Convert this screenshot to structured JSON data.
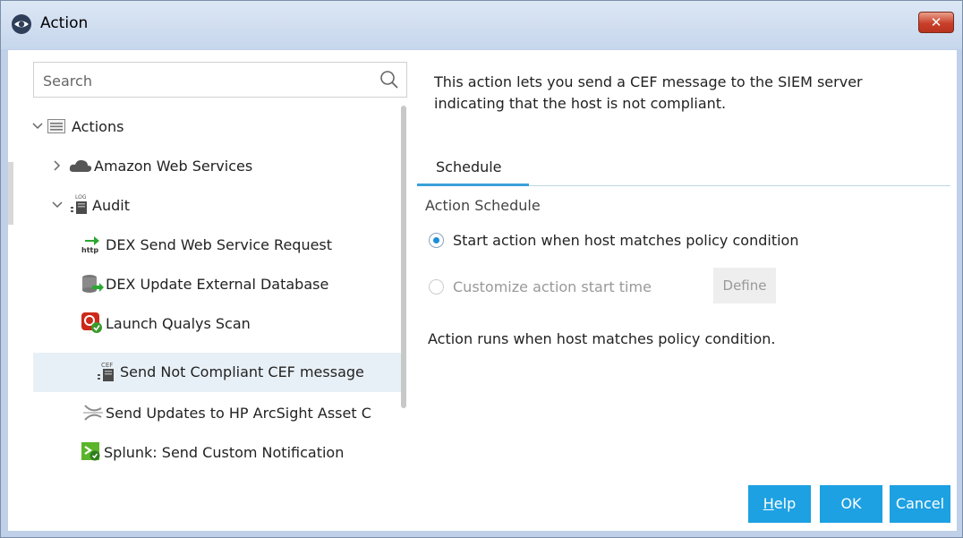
{
  "window": {
    "title": "Action",
    "close_glyph": "✕"
  },
  "search": {
    "placeholder": "Search"
  },
  "tree": {
    "root": "Actions",
    "items": [
      {
        "label": "Amazon Web Services",
        "icon": "cloud-icon"
      },
      {
        "label": "Audit",
        "icon": "log-icon"
      },
      {
        "label": "DEX Send Web Service Request",
        "icon": "http-icon"
      },
      {
        "label": "DEX Update External Database",
        "icon": "database-icon"
      },
      {
        "label": "Launch Qualys Scan",
        "icon": "qualys-icon"
      },
      {
        "label": "Send Not Compliant CEF message",
        "icon": "cef-icon",
        "selected": true
      },
      {
        "label": "Send Updates to HP ArcSight Asset C",
        "icon": "arcsight-icon"
      },
      {
        "label": "Splunk: Send Custom Notification",
        "icon": "splunk-icon"
      }
    ]
  },
  "panel": {
    "description": "This action lets you send a CEF message to the SIEM server indicating that the host is not compliant.",
    "tab": "Schedule",
    "section_label": "Action Schedule",
    "option_start": "Start action when host matches policy condition",
    "option_custom": "Customize action start time",
    "define_label": "Define",
    "note": "Action runs when host matches policy condition."
  },
  "buttons": {
    "help_first": "H",
    "help_rest": "elp",
    "ok": "OK",
    "cancel": "Cancel"
  },
  "colors": {
    "accent": "#1da1e2",
    "selected_row": "#e8f0f7",
    "close": "#c9402a"
  }
}
